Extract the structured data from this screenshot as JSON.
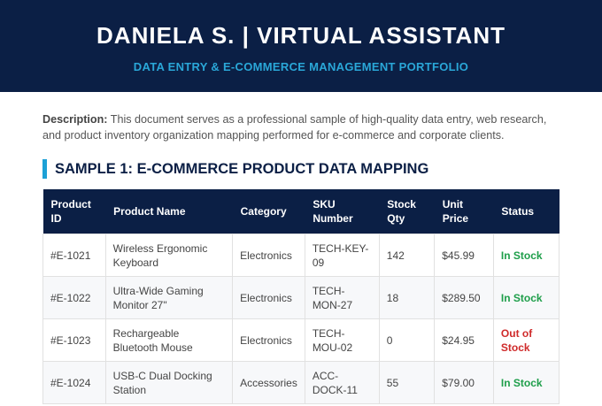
{
  "header": {
    "title": "DANIELA S. | VIRTUAL ASSISTANT",
    "subtitle": "DATA ENTRY & E-COMMERCE MANAGEMENT PORTFOLIO"
  },
  "description": {
    "label": "Description:",
    "text": " This document serves as a professional sample of high-quality data entry, web research, and product inventory organization mapping performed for e-commerce and corporate clients."
  },
  "section": {
    "title": "SAMPLE 1: E-COMMERCE PRODUCT DATA MAPPING"
  },
  "table": {
    "columns": [
      "Product ID",
      "Product Name",
      "Category",
      "SKU Number",
      "Stock Qty",
      "Unit Price",
      "Status"
    ],
    "rows": [
      {
        "id": "#E-1021",
        "name": "Wireless Ergonomic Keyboard",
        "category": "Electronics",
        "sku": "TECH-KEY-09",
        "qty": "142",
        "price": "$45.99",
        "status": "In Stock"
      },
      {
        "id": "#E-1022",
        "name": "Ultra-Wide Gaming Monitor 27\"",
        "category": "Electronics",
        "sku": "TECH-MON-27",
        "qty": "18",
        "price": "$289.50",
        "status": "In Stock"
      },
      {
        "id": "#E-1023",
        "name": "Rechargeable Bluetooth Mouse",
        "category": "Electronics",
        "sku": "TECH-MOU-02",
        "qty": "0",
        "price": "$24.95",
        "status": "Out of Stock"
      },
      {
        "id": "#E-1024",
        "name": "USB-C Dual Docking Station",
        "category": "Accessories",
        "sku": "ACC-DOCK-11",
        "qty": "55",
        "price": "$79.00",
        "status": "In Stock"
      }
    ]
  },
  "colors": {
    "header_bg": "#0b1f45",
    "accent": "#1da1d6",
    "in_stock": "#1e9e4a",
    "out_of_stock": "#cf2a2a"
  }
}
